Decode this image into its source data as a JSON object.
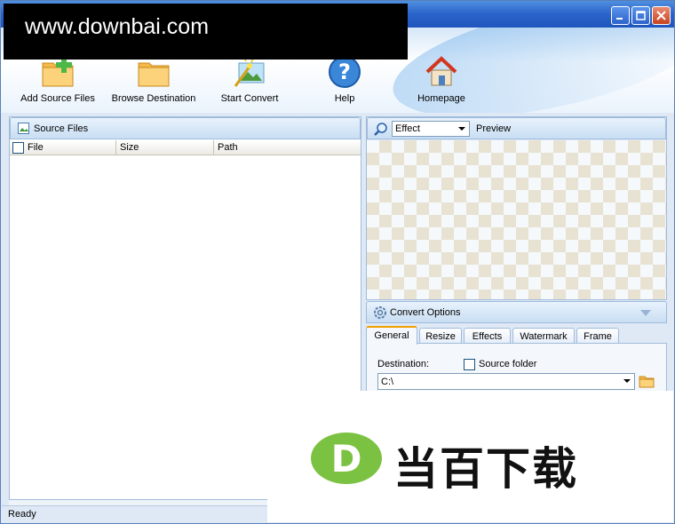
{
  "watermark": {
    "site": "www.downbai.com",
    "brand": "当百下载",
    "logo_letter": "D"
  },
  "toolbar": {
    "add_source_files": "Add Source Files",
    "browse_destination": "Browse Destination",
    "start_convert": "Start Convert",
    "help": "Help",
    "homepage": "Homepage"
  },
  "source_panel": {
    "title": "Source Files",
    "columns": [
      "File",
      "Size",
      "Path"
    ]
  },
  "preview_panel": {
    "effect_selected": "Effect",
    "title": "Preview"
  },
  "convert_options": {
    "title": "Convert Options",
    "tabs": [
      "General",
      "Resize",
      "Effects",
      "Watermark",
      "Frame"
    ],
    "active_tab": "General",
    "destination_label": "Destination:",
    "source_folder_label": "Source folder",
    "source_folder_checked": false,
    "destination_value": "C:\\"
  },
  "status": {
    "text": "Ready"
  },
  "colors": {
    "titlebar": "#2a63c9",
    "tab_accent": "#f0a000",
    "watermark_green": "#7cc242"
  }
}
